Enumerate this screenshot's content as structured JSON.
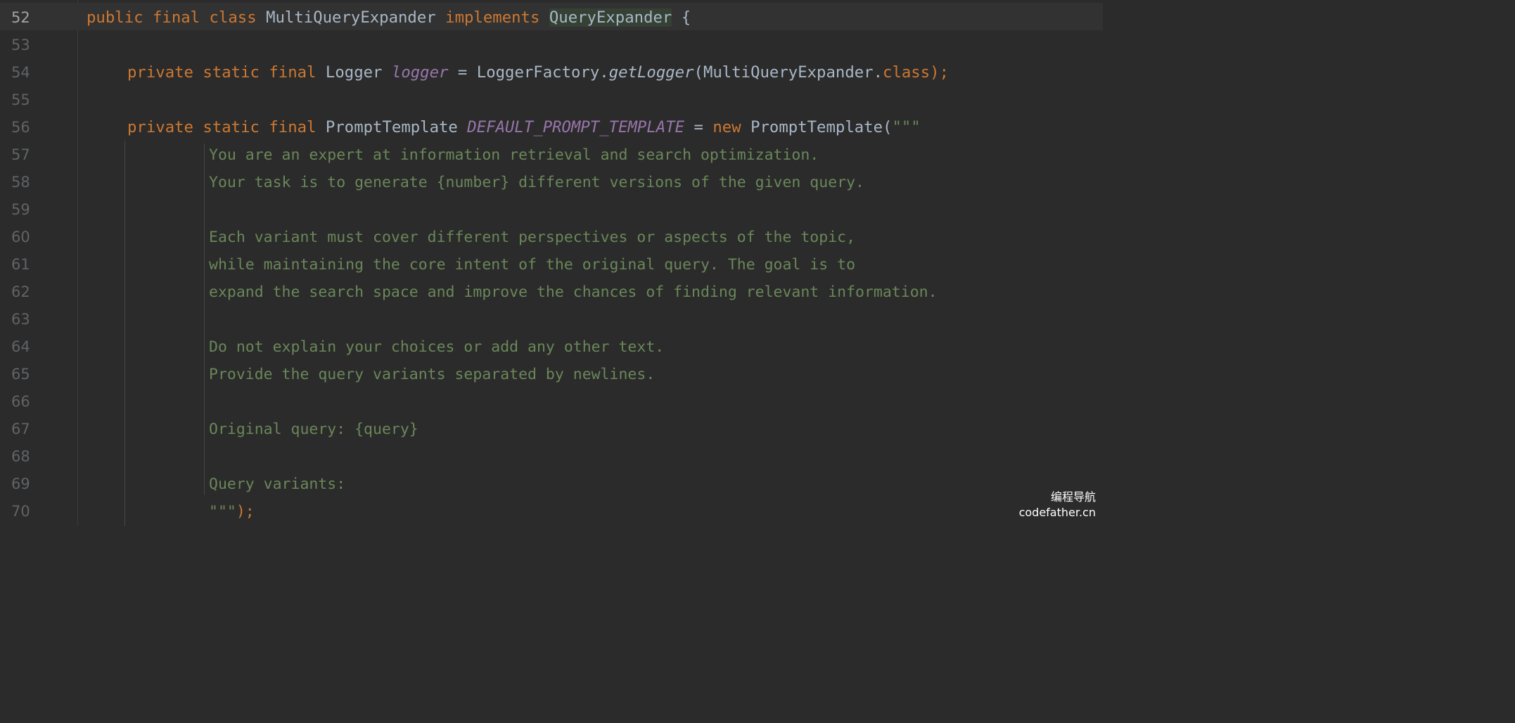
{
  "editor": {
    "language": "Java",
    "current_line": "52",
    "lines": [
      {
        "num": "52",
        "tokens": {
          "kw1": "public final class",
          "name": "MultiQueryExpander",
          "kw2": "implements",
          "iface": "QueryExpander",
          "brace": "{"
        }
      },
      {
        "num": "53"
      },
      {
        "num": "54",
        "tokens": {
          "mods": "private static final",
          "type": "Logger",
          "field": "logger",
          "eq": "=",
          "factory": "LoggerFactory.",
          "method": "getLogger",
          "open": "(MultiQueryExpander.",
          "kwclass": "class",
          "close": ");"
        }
      },
      {
        "num": "55"
      },
      {
        "num": "56",
        "tokens": {
          "mods": "private static final",
          "type": "PromptTemplate",
          "field": "DEFAULT_PROMPT_TEMPLATE",
          "eq": "=",
          "kwnew": "new",
          "ctor": "PromptTemplate(",
          "quote": "\"\"\""
        }
      },
      {
        "num": "57",
        "text": "You are an expert at information retrieval and search optimization."
      },
      {
        "num": "58",
        "text": "Your task is to generate {number} different versions of the given query."
      },
      {
        "num": "59",
        "text": ""
      },
      {
        "num": "60",
        "text": "Each variant must cover different perspectives or aspects of the topic,"
      },
      {
        "num": "61",
        "text": "while maintaining the core intent of the original query. The goal is to"
      },
      {
        "num": "62",
        "text": "expand the search space and improve the chances of finding relevant information."
      },
      {
        "num": "63",
        "text": ""
      },
      {
        "num": "64",
        "text": "Do not explain your choices or add any other text."
      },
      {
        "num": "65",
        "text": "Provide the query variants separated by newlines."
      },
      {
        "num": "66",
        "text": ""
      },
      {
        "num": "67",
        "text": "Original query: {query}"
      },
      {
        "num": "68",
        "text": ""
      },
      {
        "num": "69",
        "text": "Query variants:"
      },
      {
        "num": "70",
        "tokens": {
          "quote": "\"\"\"",
          "close": ");"
        }
      }
    ]
  },
  "watermark": {
    "line1": "编程导航",
    "line2": "codefather.cn"
  },
  "colors": {
    "background": "#2b2b2b",
    "keyword": "#cc7832",
    "identifier": "#a9b7c6",
    "field": "#9876aa",
    "string": "#6a8759",
    "line_number": "#606366"
  }
}
